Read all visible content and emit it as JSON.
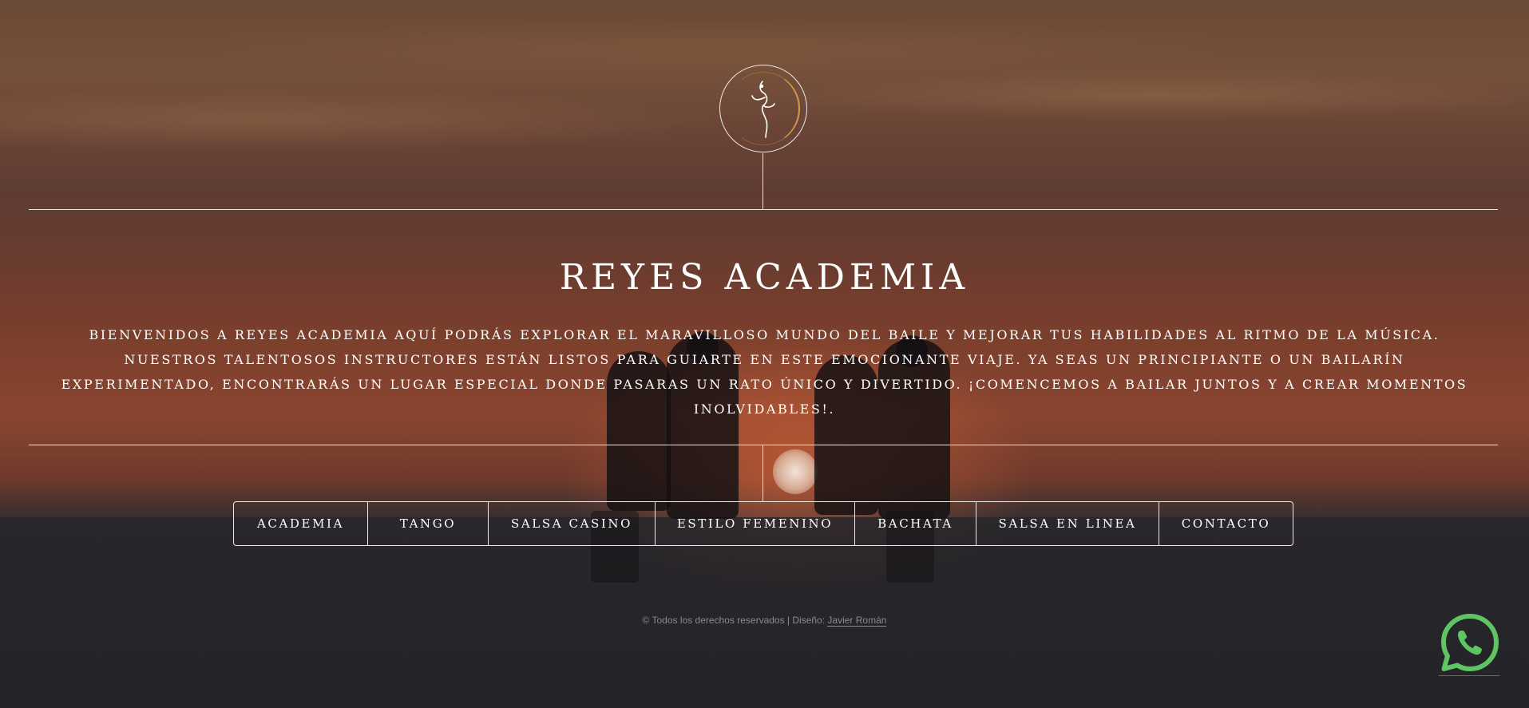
{
  "brand": {
    "logo_icon": "dancer-logo-icon",
    "title": "REYES ACADEMIA"
  },
  "intro": {
    "text": "Bienvenidos a Reyes Academia aquí podrás explorar el maravilloso mundo del baile y mejorar tus habilidades al ritmo de la música. Nuestros talentosos instructores están listos para guiarte en este emocionante viaje. Ya seas un principiante o un bailarín experimentado, encontrarás un lugar especial donde pasaras un rato único y divertido. ¡Comencemos a bailar juntos y a crear momentos inolvidables!."
  },
  "nav": {
    "items": [
      {
        "label": "ACADEMIA"
      },
      {
        "label": "TANGO"
      },
      {
        "label": "SALSA CASINO"
      },
      {
        "label": "ESTILO FEMENINO"
      },
      {
        "label": "BACHATA"
      },
      {
        "label": "SALSA EN LINEA"
      },
      {
        "label": "CONTACTO"
      }
    ]
  },
  "footer": {
    "text": "© Todos los derechos reservados | Diseño:",
    "designer": "Javier Román"
  },
  "whatsapp": {
    "icon": "whatsapp-icon",
    "color": "#5ec562"
  },
  "colors": {
    "line": "#e9e1dc",
    "logo_accent": "#d39b4a",
    "footer_text": "#8d8a8c"
  }
}
